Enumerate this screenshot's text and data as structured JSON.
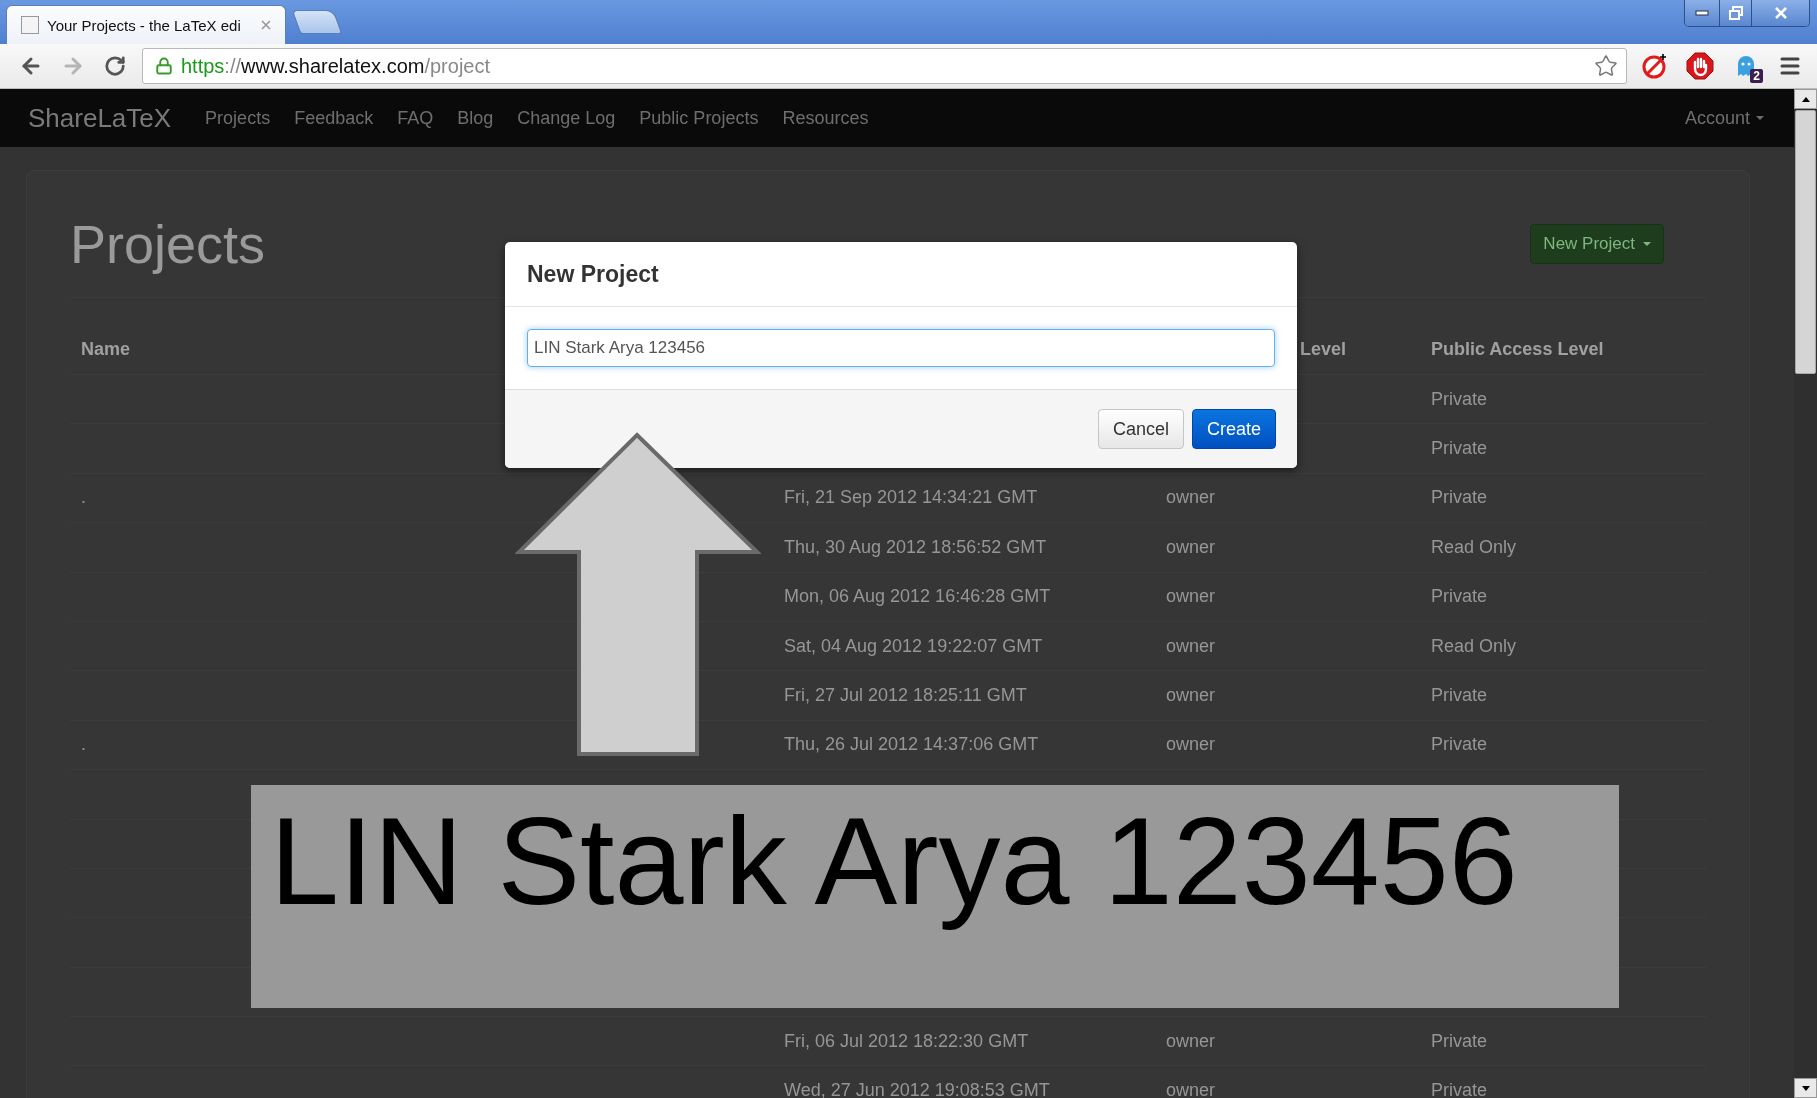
{
  "browser": {
    "tab_title": "Your Projects - the LaTeX edi",
    "url_parts": [
      {
        "kind": "scheme",
        "text": "https"
      },
      {
        "kind": "separator",
        "text": "://"
      },
      {
        "kind": "host",
        "text": "www.sharelatex.com"
      },
      {
        "kind": "path",
        "text": "/project"
      }
    ],
    "extension_badge": "2"
  },
  "navbar": {
    "brand": "ShareLaTeX",
    "links": [
      "Projects",
      "Feedback",
      "FAQ",
      "Blog",
      "Change Log",
      "Public Projects",
      "Resources"
    ],
    "account": "Account"
  },
  "page": {
    "heading": "Projects",
    "new_project_button": "New Project",
    "columns": [
      {
        "label": "Name"
      },
      {},
      {
        "label": "Level"
      },
      {
        "label": "Public Access Level"
      }
    ],
    "rows": [
      {
        "public_access": "Private"
      },
      {
        "public_access": "Private"
      },
      {
        "name": ".",
        "date": "Fri, 21 Sep 2012 14:34:21 GMT",
        "access": "owner",
        "public_access": "Private"
      },
      {
        "date": "Thu, 30 Aug 2012 18:56:52 GMT",
        "access": "owner",
        "public_access": "Read Only"
      },
      {
        "date": "Mon, 06 Aug 2012 16:46:28 GMT",
        "access": "owner",
        "public_access": "Private"
      },
      {
        "date": "Sat, 04 Aug 2012 19:22:07 GMT",
        "access": "owner",
        "public_access": "Read Only"
      },
      {
        "date": "Fri, 27 Jul 2012 18:25:11 GMT",
        "access": "owner",
        "public_access": "Private"
      },
      {
        "name": ".",
        "date": "Thu, 26 Jul 2012 14:37:06 GMT",
        "access": "owner",
        "public_access": "Private"
      },
      {},
      {},
      {},
      {},
      {},
      {
        "date": "Fri, 06 Jul 2012 18:22:30 GMT",
        "access": "owner",
        "public_access": "Private"
      },
      {
        "date": "Wed, 27 Jun 2012 19:08:53 GMT",
        "access": "owner",
        "public_access": "Private"
      }
    ]
  },
  "modal": {
    "title": "New Project",
    "value": "LIN Stark Arya 123456",
    "cancel": "Cancel",
    "create": "Create"
  },
  "annotation": {
    "text": "LIN Stark Arya 123456"
  }
}
